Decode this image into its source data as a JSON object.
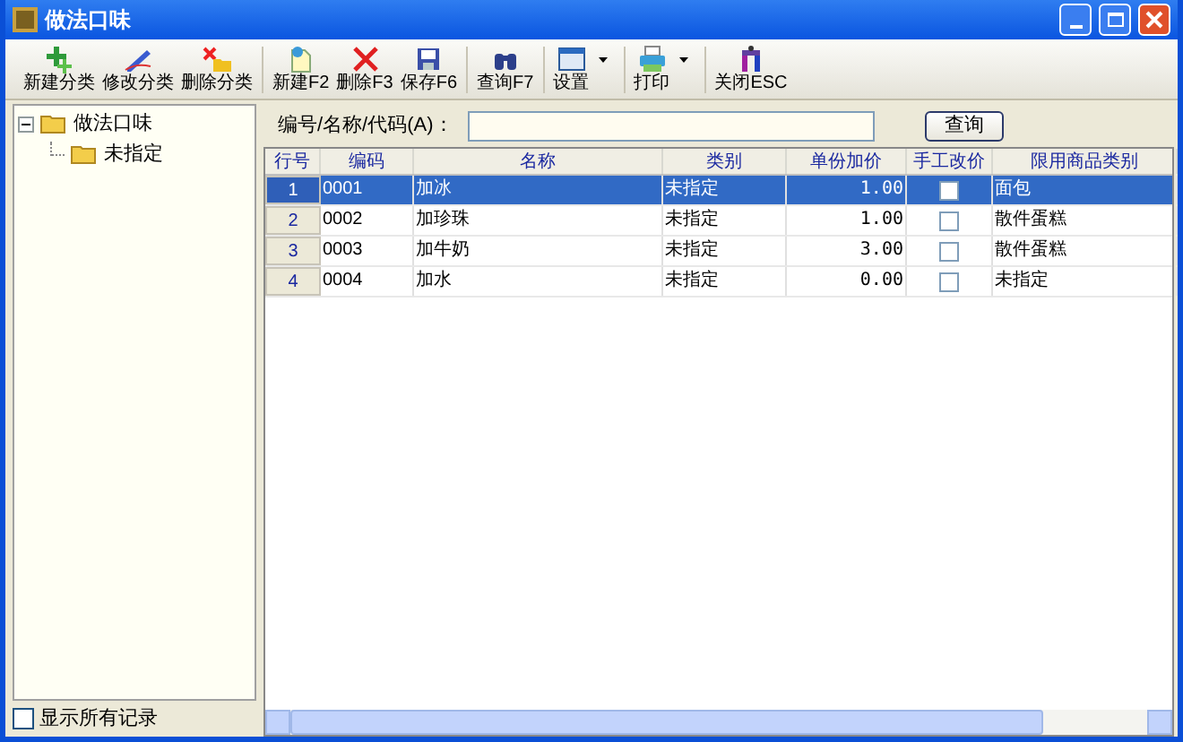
{
  "window": {
    "title": "做法口味"
  },
  "toolbar": [
    {
      "buttons": [
        {
          "label": "新建分类",
          "kind": "plus",
          "dropdown": false
        },
        {
          "label": "修改分类",
          "kind": "pen",
          "dropdown": false
        },
        {
          "label": "删除分类",
          "kind": "delcat",
          "dropdown": false
        }
      ]
    },
    {
      "buttons": [
        {
          "label": "新建F2",
          "kind": "new",
          "dropdown": false
        },
        {
          "label": "删除F3",
          "kind": "x",
          "dropdown": false
        },
        {
          "label": "保存F6",
          "kind": "save",
          "dropdown": false
        }
      ]
    },
    {
      "buttons": [
        {
          "label": "查询F7",
          "kind": "find",
          "dropdown": false
        }
      ]
    },
    {
      "buttons": [
        {
          "label": "设置",
          "kind": "window",
          "dropdown": true
        }
      ]
    },
    {
      "buttons": [
        {
          "label": "打印",
          "kind": "print",
          "dropdown": true
        }
      ]
    },
    {
      "buttons": [
        {
          "label": "关闭ESC",
          "kind": "exit",
          "dropdown": false
        }
      ]
    }
  ],
  "tree": [
    {
      "label": "做法口味",
      "expanded": true,
      "children": [
        {
          "label": "未指定"
        }
      ]
    }
  ],
  "show_all": {
    "label": "显示所有记录",
    "checked": false
  },
  "search": {
    "label": "编号/名称/代码(A)：",
    "button": "查询"
  },
  "table": {
    "columns": [
      "行号",
      "编码",
      "名称",
      "类别",
      "单份加价",
      "手工改价",
      "限用商品类别"
    ],
    "rows": [
      {
        "row": "1",
        "code": "0001",
        "name": "加冰",
        "category": "未指定",
        "price": "1.00",
        "manual": false,
        "limit": "面包",
        "selected": true
      },
      {
        "row": "2",
        "code": "0002",
        "name": "加珍珠",
        "category": "未指定",
        "price": "1.00",
        "manual": false,
        "limit": "散件蛋糕",
        "selected": false
      },
      {
        "row": "3",
        "code": "0003",
        "name": "加牛奶",
        "category": "未指定",
        "price": "3.00",
        "manual": false,
        "limit": "散件蛋糕",
        "selected": false
      },
      {
        "row": "4",
        "code": "0004",
        "name": "加水",
        "category": "未指定",
        "price": "0.00",
        "manual": false,
        "limit": "未指定",
        "selected": false
      }
    ]
  }
}
